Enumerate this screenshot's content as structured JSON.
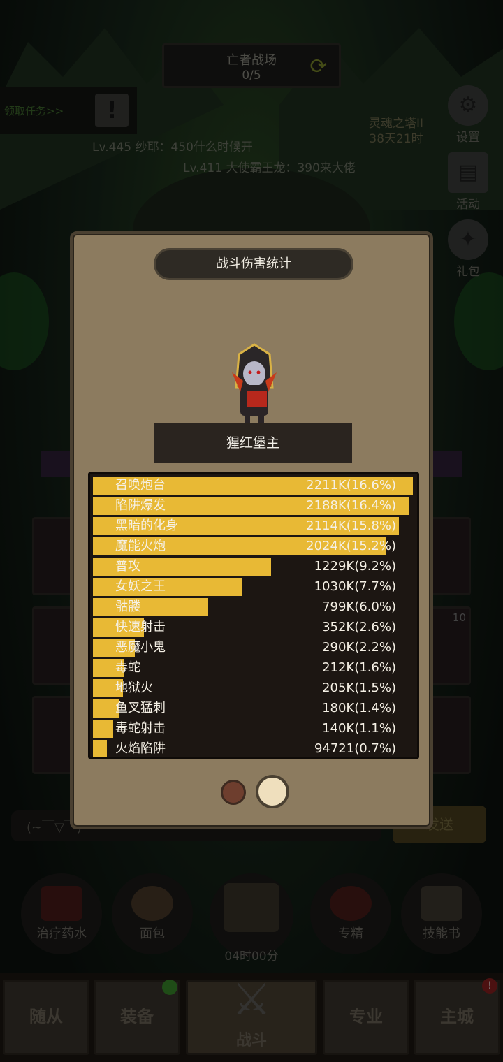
{
  "header": {
    "battlefield_title": "亡者战场",
    "battlefield_progress": "0/5",
    "task_label": "领取任务>>"
  },
  "messages": [
    "Lv.445 纱耶：450什么时候开",
    "Lv.411 大使霸王龙：390来大佬"
  ],
  "tower": {
    "name": "灵魂之塔II",
    "time_left": "38天21时"
  },
  "side_menu": [
    "设置",
    "活动",
    "礼包"
  ],
  "chat": {
    "placeholder": "(~￣▽￣)~",
    "send_label": "发送"
  },
  "actions": {
    "potion": "治疗药水",
    "bread": "面包",
    "chest_timer": "04时00分",
    "specialty": "专精",
    "skillbook": "技能书"
  },
  "card_badge": "10",
  "nav": {
    "followers": "随从",
    "equipment": "装备",
    "battle": "战斗",
    "profession": "专业",
    "main_city": "主城"
  },
  "modal": {
    "title": "战斗伤害统计",
    "boss_name": "猩红堡主",
    "damage_stats": [
      {
        "name": "召唤炮台",
        "value": "2211K(16.6%)",
        "ratio": 1.0
      },
      {
        "name": "陷阱爆发",
        "value": "2188K(16.4%)",
        "ratio": 0.989
      },
      {
        "name": "黑暗的化身",
        "value": "2114K(15.8%)",
        "ratio": 0.956
      },
      {
        "name": "魔能火炮",
        "value": "2024K(15.2%)",
        "ratio": 0.915
      },
      {
        "name": "普攻",
        "value": "1229K(9.2%)",
        "ratio": 0.556
      },
      {
        "name": "女妖之王",
        "value": "1030K(7.7%)",
        "ratio": 0.466
      },
      {
        "name": "骷髅",
        "value": "799K(6.0%)",
        "ratio": 0.361
      },
      {
        "name": "快速射击",
        "value": "352K(2.6%)",
        "ratio": 0.159
      },
      {
        "name": "恶魔小鬼",
        "value": "290K(2.2%)",
        "ratio": 0.131
      },
      {
        "name": "毒蛇",
        "value": "212K(1.6%)",
        "ratio": 0.096
      },
      {
        "name": "地狱火",
        "value": "205K(1.5%)",
        "ratio": 0.093
      },
      {
        "name": "鱼叉猛刺",
        "value": "180K(1.4%)",
        "ratio": 0.081
      },
      {
        "name": "毒蛇射击",
        "value": "140K(1.1%)",
        "ratio": 0.063
      },
      {
        "name": "火焰陷阱",
        "value": "94721(0.7%)",
        "ratio": 0.043
      }
    ],
    "page_count": 2,
    "current_page": 2
  },
  "colors": {
    "bar_fill": "#e8b935",
    "panel_bg": "#1c1612",
    "modal_bg": "#8c7b5f"
  }
}
